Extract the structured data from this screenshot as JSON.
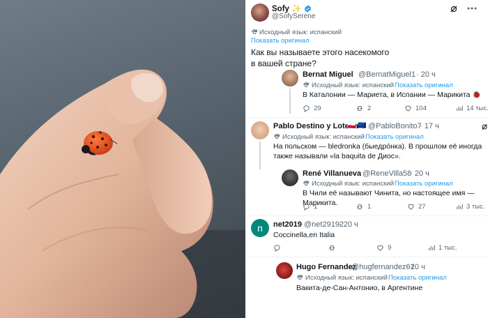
{
  "main_post": {
    "author_name": "Sofy",
    "author_emoji": "✨",
    "handle": "@SofySerene",
    "lang_notice": "Исходный язык: испанский",
    "show_original": "Показать оригинал",
    "text": "Как вы называете этого насекомого в вашей стране?"
  },
  "replies": [
    {
      "author": "Bernat Miguel",
      "handle": "@BernatMiguel1",
      "time": "· 20 ч",
      "lang_notice": "Исходный язык: испанский",
      "show_original": "Показать оригинал",
      "text": "В Каталонии — Мариета, в Испании — Марикита 🐞",
      "replies": "29",
      "reposts": "2",
      "likes": "104",
      "views": "14 тыс."
    },
    {
      "author": "Pablo Destino y Lotería",
      "flags": "🇵🇱 🇪🇺",
      "handle": "@PabloBonito7",
      "time": "· 17 ч",
      "lang_notice": "Исходный язык: испанский",
      "show_original": "Показать оригинал",
      "text": "На польском — bledronka (быедрóнка). В прошлом её иногда также называли «la baquita de Диос»."
    },
    {
      "author": "René Villanueva",
      "handle": "@ReneVilla58",
      "time": "· 20 ч",
      "lang_notice": "Исходный язык: испанский",
      "show_original": "Показать оригинал",
      "text": "В Чили её называют Чинита, но настоящее имя — Марикита.",
      "replies": "1",
      "reposts": "1",
      "likes": "27",
      "views": "3 тыс."
    },
    {
      "author": "net2019",
      "avatar_letter": "n",
      "handle": "@net29192",
      "time": "· 20 ч",
      "text": "Coccinella,en Italia",
      "replies": "",
      "reposts": "",
      "likes": "9",
      "views": "1 тыс."
    },
    {
      "author": "Hugo Fernandez",
      "handle": "@hugfernandez61",
      "time": "· 20 ч",
      "lang_notice": "Исходный язык: испанский",
      "show_original": "Показать оригинал",
      "text": "Вакита-де-Сан-Антонио, в Аргентине"
    }
  ],
  "colors": {
    "accent": "#1d9bf0",
    "secondary_text": "#536471",
    "net_avatar": "#00897b"
  }
}
